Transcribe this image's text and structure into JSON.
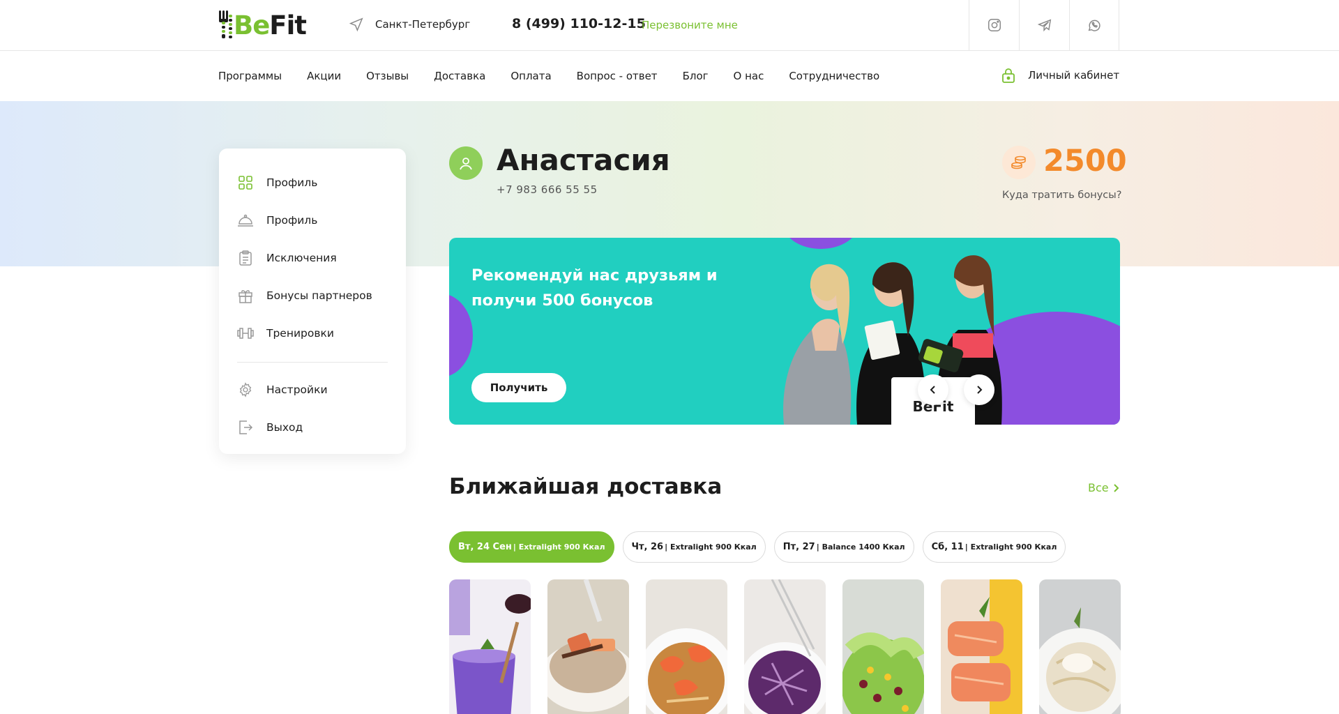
{
  "header": {
    "logo": {
      "be": "Be",
      "fit": "Fit"
    },
    "city": "Санкт-Петербург",
    "phone": "8 (499) 110-12-15",
    "callback": "Перезвоните мне",
    "socials": [
      "instagram-icon",
      "telegram-icon",
      "whatsapp-icon"
    ]
  },
  "nav": {
    "items": [
      "Программы",
      "Акции",
      "Отзывы",
      "Доставка",
      "Оплата",
      "Вопрос - ответ",
      "Блог",
      "О нас",
      "Сотрудничество"
    ],
    "cabinet": "Личный кабинет"
  },
  "sidebar": {
    "items": [
      {
        "label": "Профиль",
        "icon": "grid-icon"
      },
      {
        "label": "Профиль",
        "icon": "cloche-icon"
      },
      {
        "label": "Исключения",
        "icon": "clipboard-icon"
      },
      {
        "label": "Бонусы партнеров",
        "icon": "gift-icon"
      },
      {
        "label": "Тренировки",
        "icon": "dumbbell-icon"
      }
    ],
    "bottom": [
      {
        "label": "Настройки",
        "icon": "gear-icon"
      },
      {
        "label": "Выход",
        "icon": "logout-icon"
      }
    ]
  },
  "user": {
    "name": "Анастасия",
    "phone": "+7 983 666 55 55",
    "bonus": "2500",
    "bonus_link": "Куда тратить бонусы?"
  },
  "banner": {
    "title": "Рекомендуй нас друзьям и получи 500 бонусов",
    "button": "Получить",
    "bag_text": "BeFit"
  },
  "delivery": {
    "title": "Ближайшая доставка",
    "all": "Все",
    "chips": [
      {
        "day": "Вт, 24 Сен",
        "plan": "| Extralight 900 Ккал",
        "active": true
      },
      {
        "day": "Чт, 26",
        "plan": "| Extralight 900 Ккал",
        "active": false
      },
      {
        "day": "Пт, 27",
        "plan": "| Balance 1400 Ккал",
        "active": false
      },
      {
        "day": "Сб, 11",
        "plan": "| Extralight 900 Ккал",
        "active": false
      }
    ],
    "dishes": [
      "purple-smoothie",
      "rice-porridge",
      "shrimp-noodles",
      "cabbage-salad",
      "bean-salad",
      "salmon-fillet",
      "creamy-pasta"
    ]
  },
  "colors": {
    "accent": "#7ac031",
    "bonus": "#f38a2b",
    "banner": "#21cfc0",
    "purple": "#8b4fe0"
  }
}
